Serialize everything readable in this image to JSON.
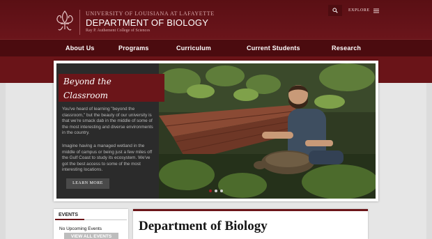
{
  "header": {
    "university": "UNIVERSITY OF LOUISIANA AT LAFAYETTE",
    "department": "DEPARTMENT OF BIOLOGY",
    "college": "Ray P. Authement College of Sciences",
    "explore_label": "EXPLORE"
  },
  "nav": {
    "items": [
      {
        "label": "About Us"
      },
      {
        "label": "Programs"
      },
      {
        "label": "Curriculum"
      },
      {
        "label": "Current Students"
      },
      {
        "label": "Research"
      }
    ]
  },
  "hero": {
    "title_line1": "Beyond the",
    "title_line2": "Classroom",
    "paragraph1": "You've heard of learning \"beyond the classroom,\" but the beauty of our university is that we're smack dab in the middle of some of the most interesting and diverse environments in the country.",
    "paragraph2": "Imagine having a managed wetland in the middle of campus or being just a few miles off the Gulf Coast to study its ecosystem. We've got the best access to some of the most interesting locations.",
    "button_label": "LEARN MORE",
    "active_slide": 1,
    "slide_count": 3
  },
  "events": {
    "tab_label": "EVENTS",
    "empty_text": "No Upcoming Events",
    "button_label": "VIEW ALL EVENTS"
  },
  "main": {
    "title": "Department of Biology"
  },
  "colors": {
    "brand": "#6b1519",
    "header_bg": "#5a0f14",
    "nav_bg": "#4b0b0f"
  }
}
